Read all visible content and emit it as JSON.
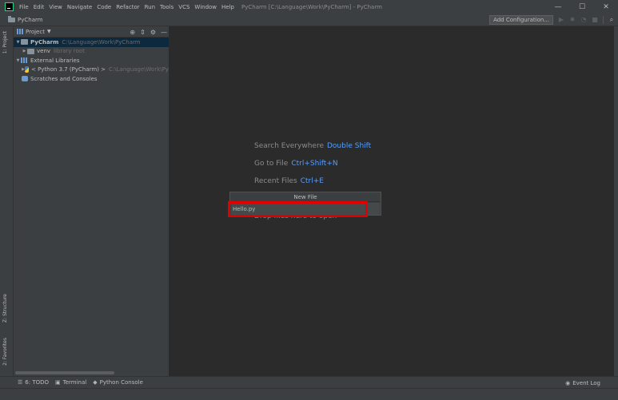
{
  "menu": [
    "File",
    "Edit",
    "View",
    "Navigate",
    "Code",
    "Refactor",
    "Run",
    "Tools",
    "VCS",
    "Window",
    "Help"
  ],
  "window_title": "PyCharm [C:\\Language\\Work\\PyCharm] - PyCharm",
  "window_controls": {
    "minimize": "—",
    "maximize": "☐",
    "close": "✕"
  },
  "navbar": {
    "project": "PyCharm",
    "add_config": "Add Configuration..."
  },
  "left_strip": {
    "project_tab": "1: Project",
    "structure_tab": "Z: Structure",
    "favorites_tab": "2: Favorites"
  },
  "project_panel": {
    "title": "Project",
    "tree": [
      {
        "label": "PyCharm",
        "path": "C:\\Language\\Work\\PyCharm"
      },
      {
        "label": "venv",
        "path": "library root"
      },
      {
        "label": "External Libraries"
      },
      {
        "label": "< Python 3.7 (PyCharm) >",
        "path": "C:\\Language\\Work\\Py"
      },
      {
        "label": "Scratches and Consoles"
      }
    ]
  },
  "editor_hints": [
    {
      "label": "Search Everywhere",
      "key": "Double Shift"
    },
    {
      "label": "Go to File",
      "key": "Ctrl+Shift+N"
    },
    {
      "label": "Recent Files",
      "key": "Ctrl+E"
    }
  ],
  "drop_hint": "Drop files here to open",
  "new_file_popup": {
    "title": "New File",
    "value": "Hello.py"
  },
  "bottom_bar": {
    "todo": "6: TODO",
    "terminal": "Terminal",
    "python_console": "Python Console",
    "event_log": "Event Log"
  }
}
